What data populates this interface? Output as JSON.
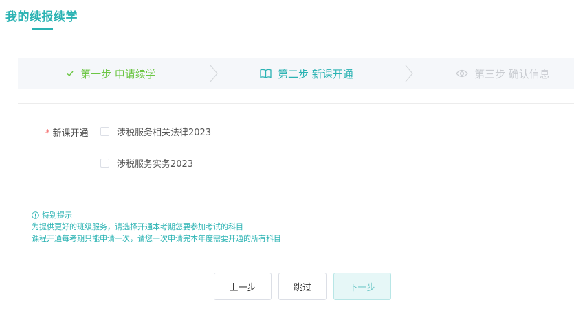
{
  "header": {
    "title": "我的续报续学"
  },
  "steps": [
    {
      "label": "第一步 申请续学",
      "icon": "check-icon",
      "state": "done",
      "color": "#6cc644"
    },
    {
      "label": "第二步 新课开通",
      "icon": "book-icon",
      "state": "active",
      "color": "#2bb3b3"
    },
    {
      "label": "第三步 确认信息",
      "icon": "eye-icon",
      "state": "pending",
      "color": "#c9ccd1"
    }
  ],
  "form": {
    "required_mark": "*",
    "label": "新课开通",
    "courses": [
      {
        "name": "涉税服务相关法律2023",
        "checked": false
      },
      {
        "name": "涉税服务实务2023",
        "checked": false
      }
    ]
  },
  "tips": {
    "title": "特别提示",
    "lines": [
      "为提供更好的班级服务，请选择开通本考期您要参加考试的科目",
      "课程开通每考期只能申请一次，请您一次申请完本年度需要开通的所有科目"
    ]
  },
  "buttons": {
    "prev": "上一步",
    "skip": "跳过",
    "next": "下一步"
  },
  "colors": {
    "accent": "#2bb3b3",
    "done": "#6cc644",
    "required": "#f56c6c"
  }
}
